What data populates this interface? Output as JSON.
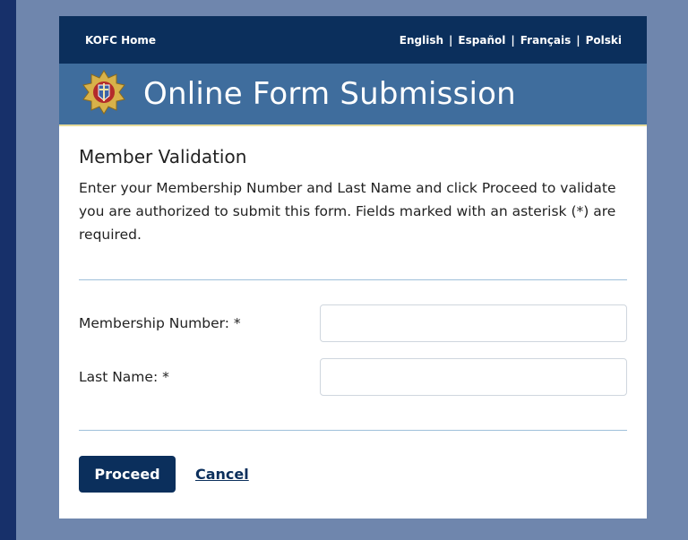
{
  "header": {
    "home_link": "KOFC Home",
    "languages": [
      "English",
      "Español",
      "Français",
      "Polski"
    ],
    "separator": "|"
  },
  "banner": {
    "title": "Online Form Submission",
    "logo_icon": "kofc-emblem-icon"
  },
  "main": {
    "section_title": "Member Validation",
    "intro": "Enter your Membership Number and Last Name and click Proceed to validate you are authorized to submit this form. Fields marked with an asterisk (*) are required.",
    "fields": {
      "membership_label": "Membership Number: *",
      "membership_value": "",
      "last_name_label": "Last Name: *",
      "last_name_value": ""
    },
    "actions": {
      "proceed_label": "Proceed",
      "cancel_label": "Cancel"
    }
  },
  "colors": {
    "dark_navy": "#0b2f5c",
    "banner_blue": "#3f6d9d",
    "outer_bg": "#6f86ad",
    "divider": "#9fc0da"
  }
}
